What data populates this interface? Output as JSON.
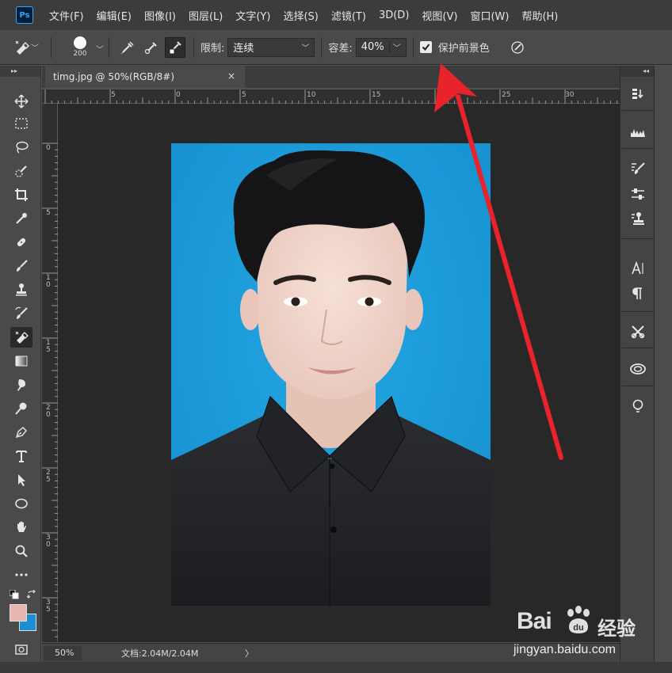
{
  "app": {
    "logo": "Ps"
  },
  "menu": [
    "文件(F)",
    "编辑(E)",
    "图像(I)",
    "图层(L)",
    "文字(Y)",
    "选择(S)",
    "滤镜(T)",
    "3D(D)",
    "视图(V)",
    "窗口(W)",
    "帮助(H)"
  ],
  "options": {
    "brush_size": "200",
    "limit_label": "限制:",
    "limit_value": "连续",
    "tolerance_label": "容差:",
    "tolerance_value": "40%",
    "protect_label": "保护前景色",
    "protect_checked": true
  },
  "document": {
    "tab_title": "timg.jpg @ 50%(RGB/8#)",
    "close_glyph": "×",
    "ruler_h": [
      "5",
      "0",
      "5",
      "10",
      "15",
      "20",
      "25",
      "30"
    ],
    "ruler_v": [
      "0",
      "5",
      "1\n0",
      "1\n5",
      "2\n0",
      "2\n5",
      "3\n0",
      "3\n5"
    ]
  },
  "status": {
    "zoom": "50%",
    "doc_info": "文档:2.04M/2.04M",
    "arrow": "〉"
  },
  "colors": {
    "foreground": "#e8b8b0",
    "background": "#1a8fd6",
    "photo_bg": "#1a9ad8",
    "annotation_arrow": "#e8232a"
  },
  "tools": [
    "move-icon",
    "marquee-icon",
    "lasso-icon",
    "quick-select-icon",
    "crop-icon",
    "eyedropper-icon",
    "healing-brush-icon",
    "brush-icon",
    "clone-stamp-icon",
    "history-brush-icon",
    "background-eraser-icon",
    "gradient-icon",
    "blur-icon",
    "dodge-icon",
    "pen-icon",
    "type-icon",
    "path-select-icon",
    "ellipse-icon",
    "hand-icon",
    "zoom-icon",
    "more-tools-icon"
  ],
  "watermark": {
    "brand": "Bai",
    "brand_suffix": "经验",
    "url": "jingyan.baidu.com"
  }
}
